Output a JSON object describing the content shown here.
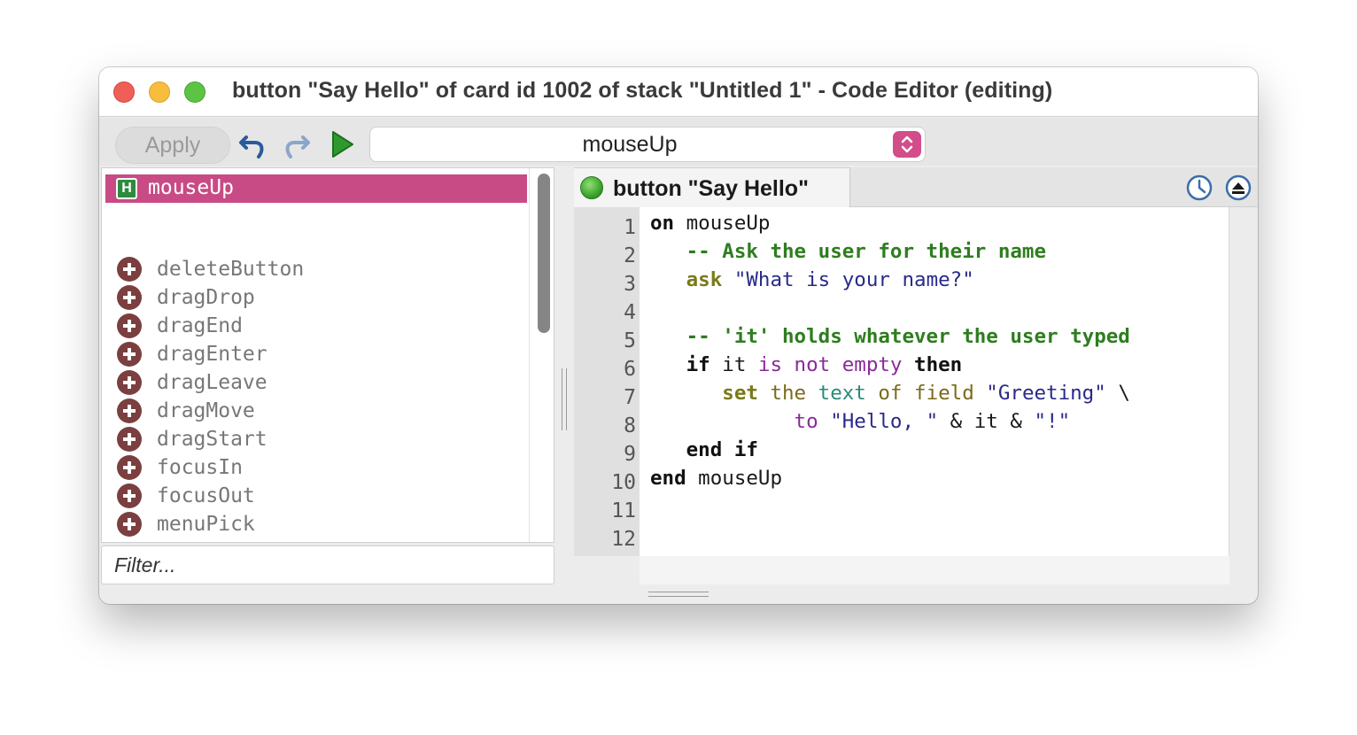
{
  "window": {
    "title": "button \"Say Hello\" of card id 1002 of stack \"Untitled 1\" - Code Editor (editing)"
  },
  "toolbar": {
    "apply_label": "Apply",
    "handler_select_value": "mouseUp",
    "icons": {
      "undo": "undo-icon",
      "redo": "redo-icon",
      "run": "run-icon"
    }
  },
  "handler_list": {
    "selected": {
      "badge": "H",
      "label": "mouseUp"
    },
    "messages": [
      "deleteButton",
      "dragDrop",
      "dragEnd",
      "dragEnter",
      "dragLeave",
      "dragMove",
      "dragStart",
      "focusIn",
      "focusOut",
      "menuPick"
    ],
    "filter_placeholder": "Filter..."
  },
  "editor": {
    "tab_label": "button \"Say Hello\"",
    "line_numbers": [
      "1",
      "2",
      "3",
      "4",
      "5",
      "6",
      "7",
      "8",
      "9",
      "10",
      "11",
      "12"
    ],
    "code": {
      "l1_kw": "on",
      "l1_name": " mouseUp",
      "l2": "   -- Ask the user for their name",
      "l3_cmd": "   ask",
      "l3_str": " \"What is your name?\"",
      "l5": "   -- 'it' holds whatever the user typed",
      "l6_if": "   if",
      "l6_it": " it",
      "l6_is": " is not",
      "l6_empty": " empty",
      "l6_then": " then",
      "l7_set": "      set",
      "l7_the": " the",
      "l7_text": " text",
      "l7_of": " of",
      "l7_field": " field",
      "l7_str": " \"Greeting\"",
      "l7_cont": " \\",
      "l8_to": "            to",
      "l8_str": " \"Hello, \"",
      "l8_rest": " & it & ",
      "l8_str2": "\"!\"",
      "l9": "   end if",
      "l10_kw": "end",
      "l10_name": " mouseUp"
    },
    "colors": {
      "comment": "#2e7d1f",
      "command": "#7a7a1a",
      "string": "#2a2a8a",
      "accent": "#c84b85"
    }
  }
}
